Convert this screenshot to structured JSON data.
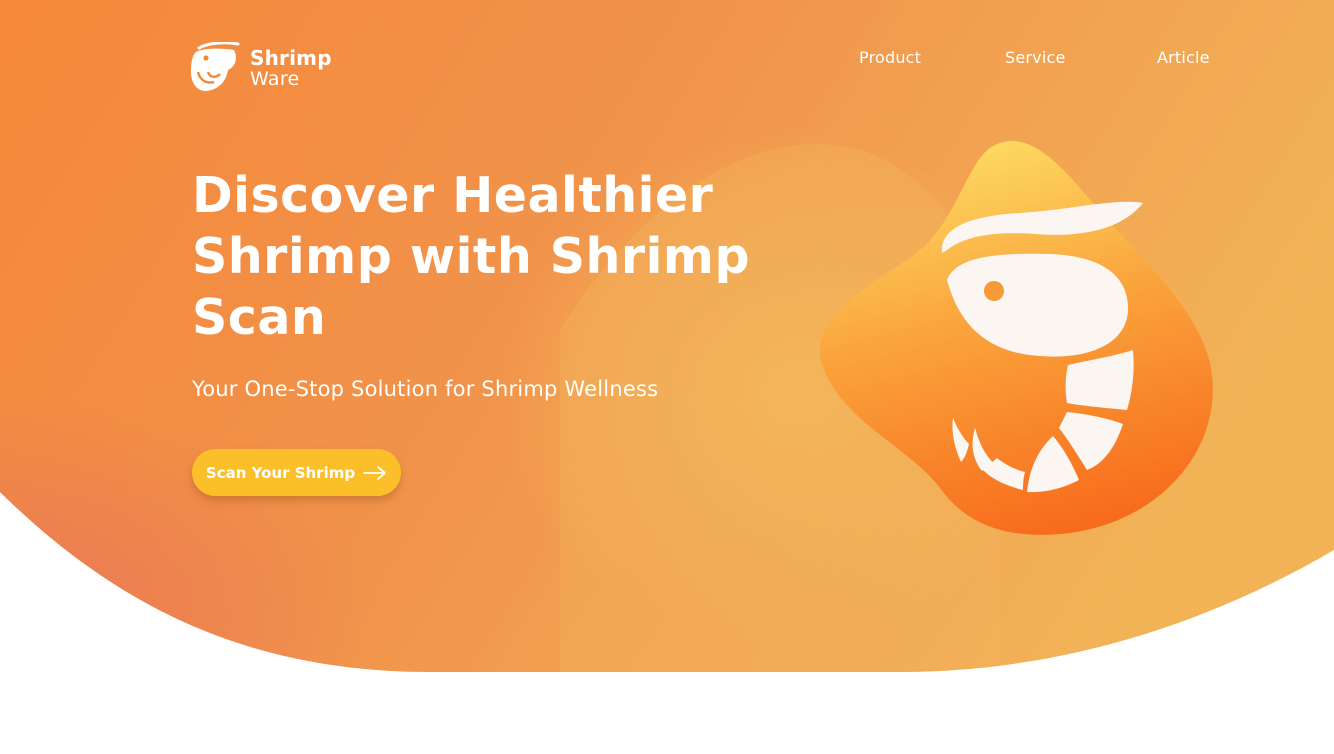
{
  "brand": {
    "name_line1": "Shrimp",
    "name_line2": "Ware",
    "logo_icon": "shrimp-icon"
  },
  "nav": {
    "items": [
      {
        "label": "Product"
      },
      {
        "label": "Service"
      },
      {
        "label": "Article"
      }
    ]
  },
  "hero": {
    "title_line1": "Discover Healthier",
    "title_line2": "Shrimp with Shrimp",
    "title_line3": "Scan",
    "subtitle": "Your One-Stop Solution for Shrimp Wellness",
    "cta_label": "Scan Your Shrimp",
    "cta_icon": "arrow-right-icon",
    "illustration_icon": "shrimp-icon"
  },
  "colors": {
    "brand_orange": "#f58a34",
    "warm_yellow": "#f3b35a",
    "cta_yellow": "#fbbf2a",
    "blob_top": "#fddc62",
    "blob_bottom": "#f76b1c",
    "text_white": "#ffffff"
  }
}
